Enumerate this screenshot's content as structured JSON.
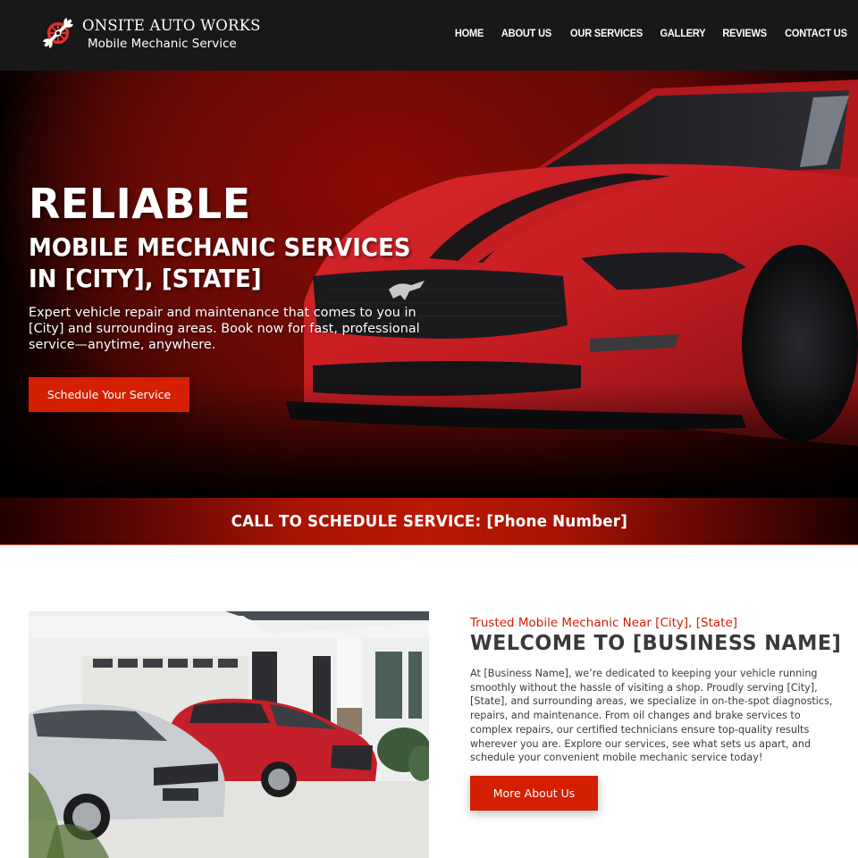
{
  "header": {
    "brand_name": "ONSITE AUTO WORKS",
    "brand_tagline": "Mobile Mechanic Service",
    "logo_icon": "wrench-wheel-icon",
    "nav": [
      {
        "label": "HOME"
      },
      {
        "label": "ABOUT US"
      },
      {
        "label": "OUR SERVICES"
      },
      {
        "label": "GALLERY"
      },
      {
        "label": "REVIEWS"
      },
      {
        "label": "CONTACT US"
      }
    ]
  },
  "hero": {
    "title_line1": "RELIABLE",
    "title_line2": "MOBILE MECHANIC SERVICES IN [CITY], [STATE]",
    "subtitle": "Expert vehicle repair and maintenance that comes to you in [City] and surrounding areas. Book now for fast, professional service—anytime, anywhere.",
    "cta_label": "Schedule Your Service",
    "image_alt": "Red sports car with black racing stripes"
  },
  "cta_bar": {
    "text": "CALL TO SCHEDULE SERVICE: [Phone Number]"
  },
  "about": {
    "image_alt": "Silver and red hatchbacks parked in a driveway in front of a white house",
    "kicker": "Trusted Mobile Mechanic Near [City], [State]",
    "title": "WELCOME TO [BUSINESS NAME]",
    "body": "At [Business Name], we’re dedicated to keeping your vehicle running smoothly without the hassle of visiting a shop. Proudly serving [City], [State], and surrounding areas, we specialize in on-the-spot diagnostics, repairs, and maintenance. From oil changes and brake services to complex repairs, our certified technicians ensure top-quality results wherever you are. Explore our services, see what sets us apart, and schedule your convenient mobile mechanic service today!",
    "button_label": "More About Us"
  },
  "colors": {
    "accent": "#d41f02",
    "header_bg": "#181818",
    "heading_dark": "#3a3a3a"
  }
}
